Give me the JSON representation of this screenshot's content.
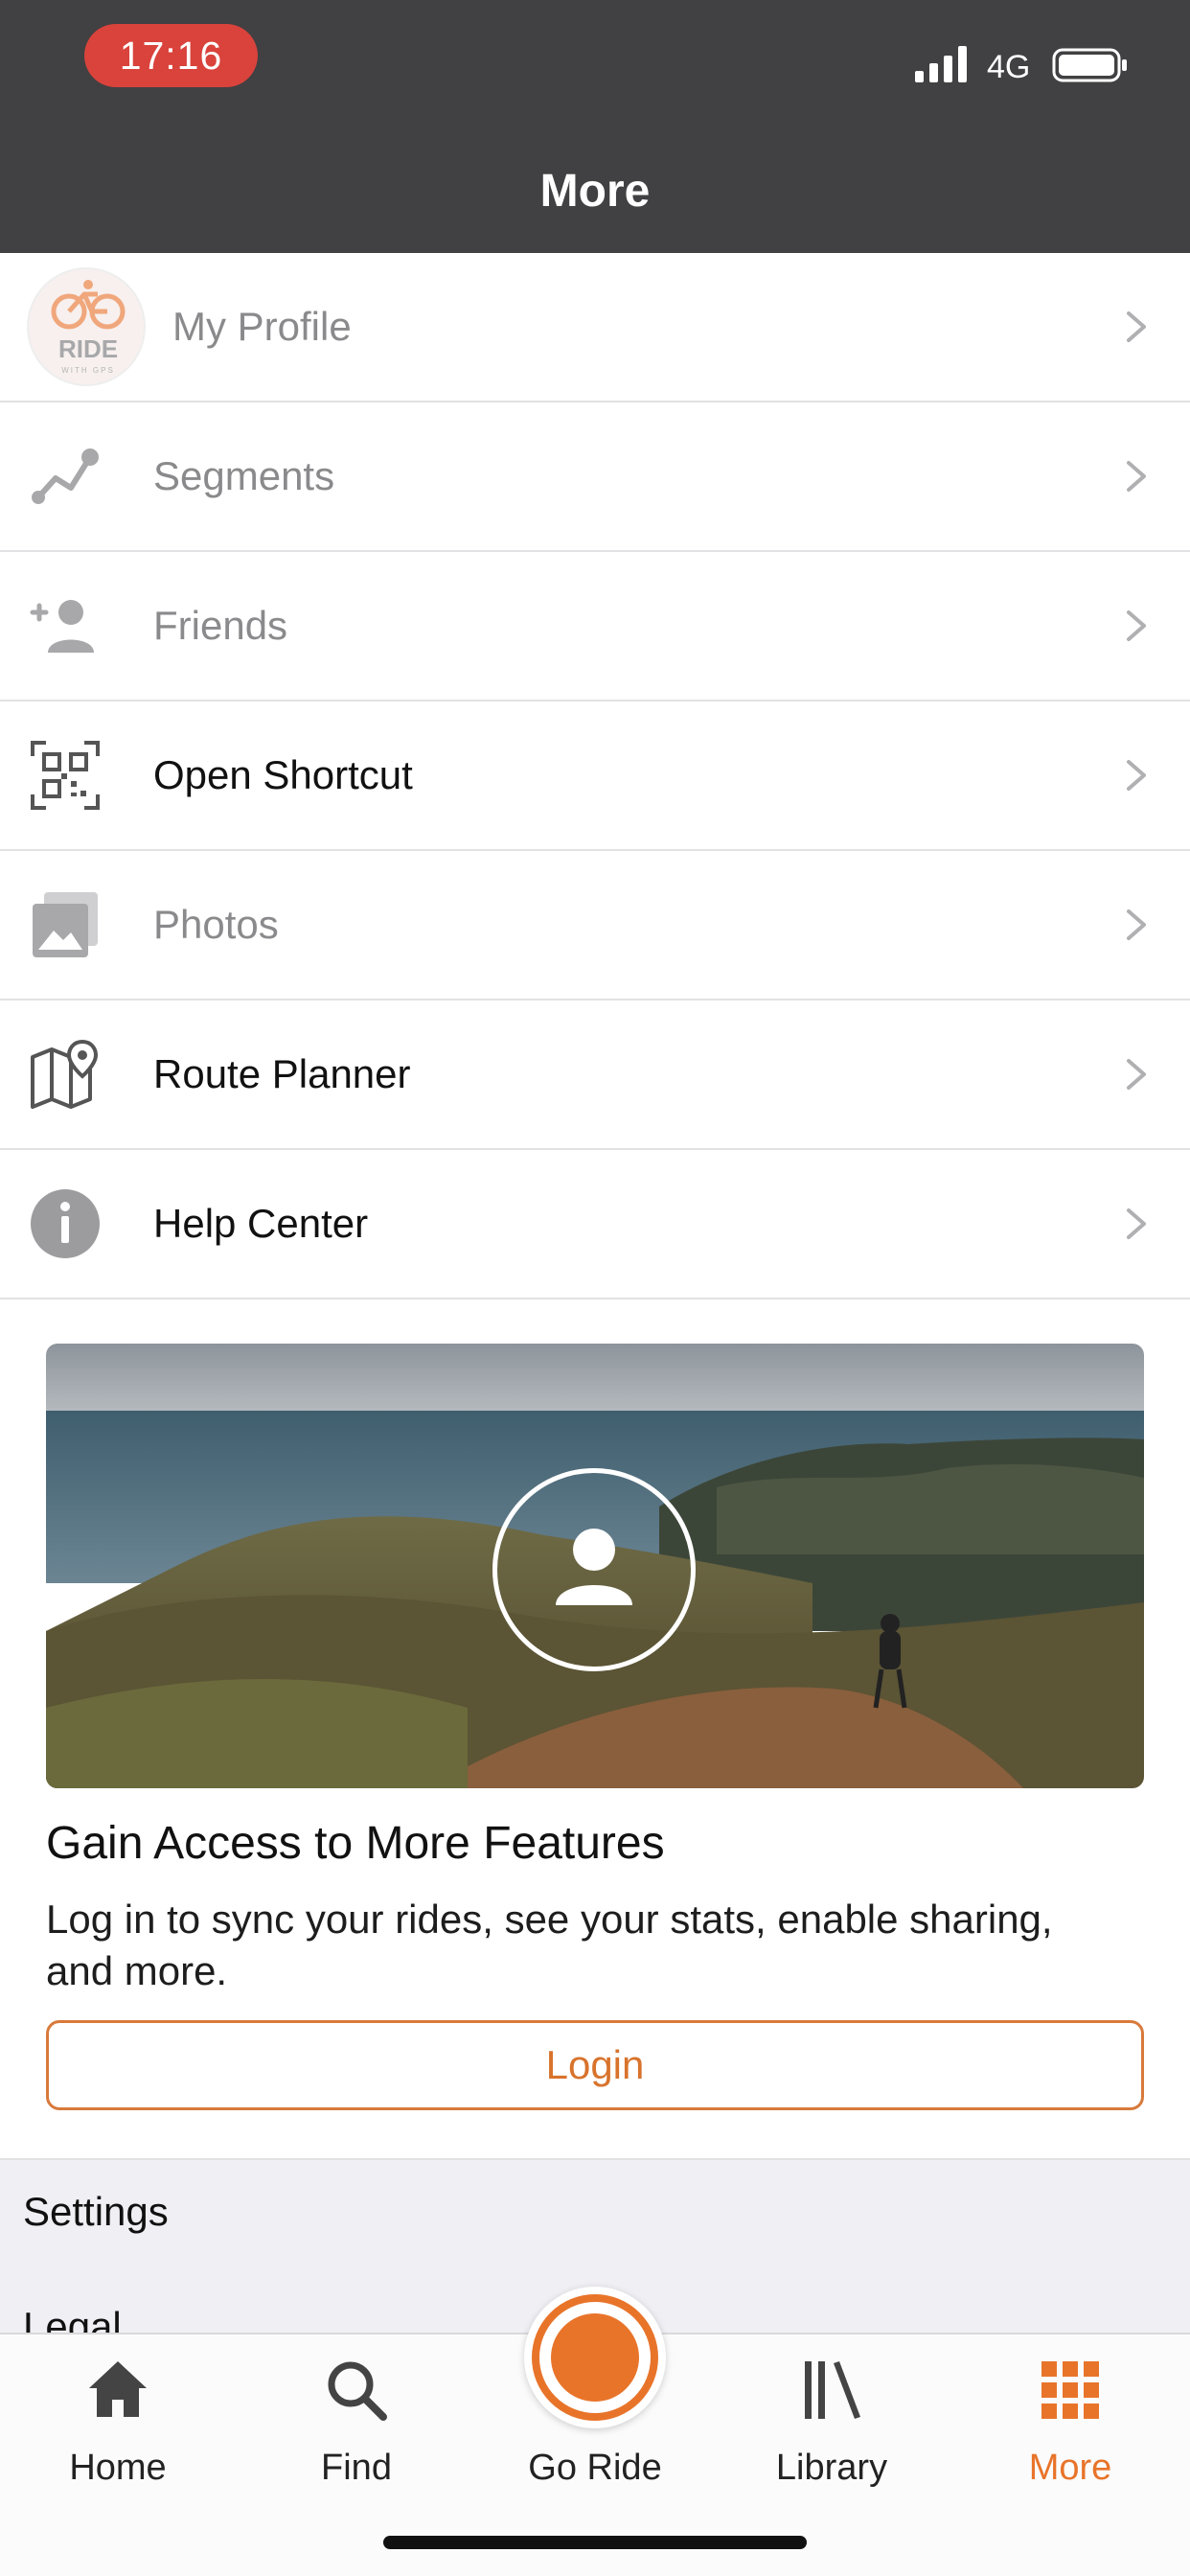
{
  "status_bar": {
    "time": "17:16",
    "network": "4G"
  },
  "header": {
    "title": "More"
  },
  "menu": {
    "profile": {
      "label": "My Profile",
      "avatar_text": "RIDE",
      "avatar_subtext": "WITH GPS"
    },
    "items": [
      {
        "label": "Segments",
        "icon": "segments-icon",
        "style": "dim"
      },
      {
        "label": "Friends",
        "icon": "add-friend-icon",
        "style": "dim"
      },
      {
        "label": "Open Shortcut",
        "icon": "qr-code-icon",
        "style": "dark"
      },
      {
        "label": "Photos",
        "icon": "photos-icon",
        "style": "dim"
      },
      {
        "label": "Route Planner",
        "icon": "map-pin-icon",
        "style": "dark"
      },
      {
        "label": "Help Center",
        "icon": "info-icon",
        "style": "dark"
      }
    ]
  },
  "promo": {
    "title": "Gain Access to More Features",
    "body": "Log in to sync your rides, see your stats, enable sharing, and more.",
    "login_label": "Login"
  },
  "settings": {
    "title": "Settings",
    "legal": "Legal"
  },
  "tabbar": {
    "tabs": [
      {
        "label": "Home",
        "icon": "home-icon"
      },
      {
        "label": "Find",
        "icon": "search-icon"
      },
      {
        "label": "Go Ride",
        "icon": "record-icon"
      },
      {
        "label": "Library",
        "icon": "library-icon"
      },
      {
        "label": "More",
        "icon": "grid-icon",
        "active": true
      }
    ]
  },
  "colors": {
    "header_bg": "#414042",
    "accent": "#e8742a",
    "time_pill": "#d9433c",
    "icon_gray": "#9c9c9e"
  }
}
